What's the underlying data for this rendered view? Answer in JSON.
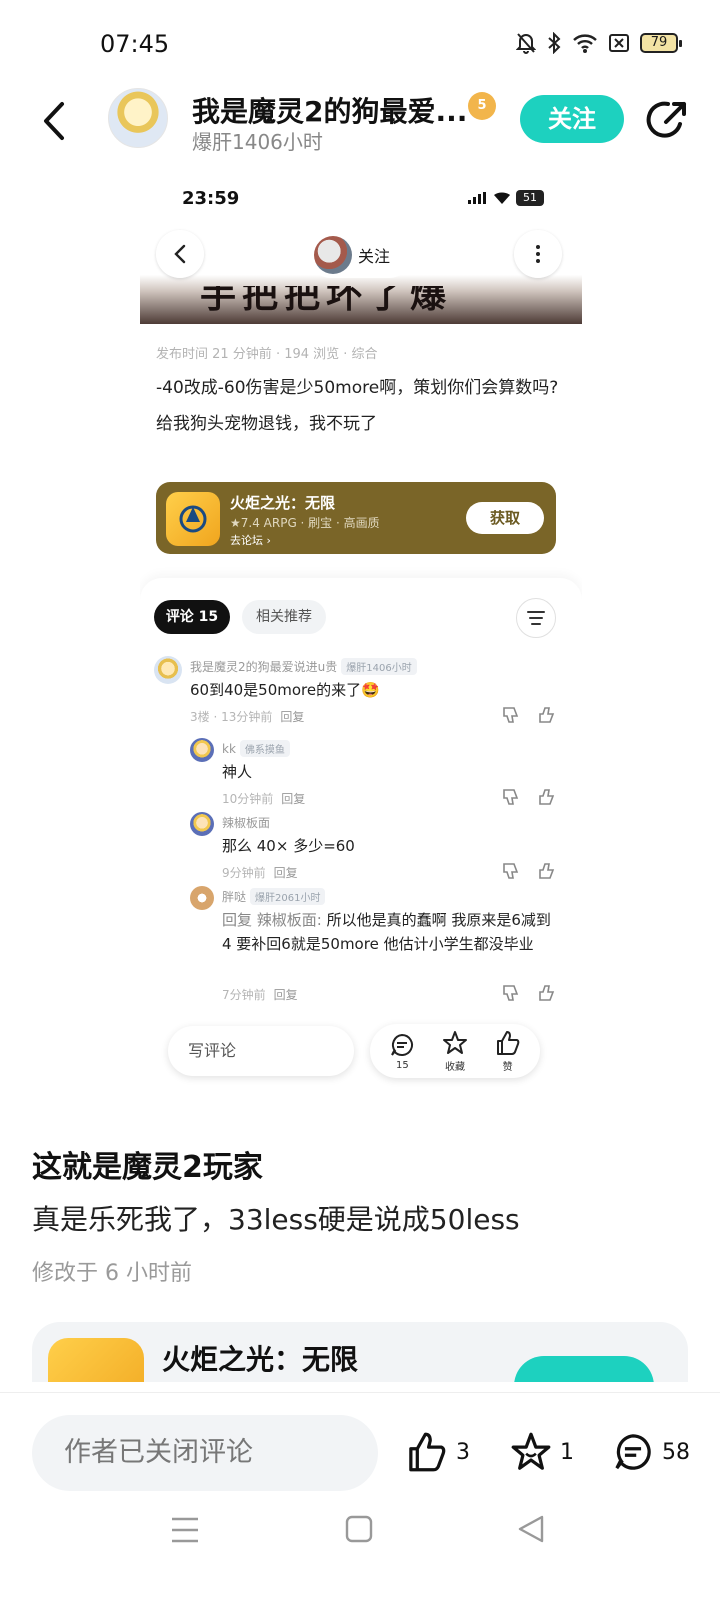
{
  "status_bar": {
    "time": "07:45",
    "battery": "79"
  },
  "header": {
    "name": "我是魔灵2的狗最爱...",
    "level": "5",
    "subtitle": "爆肝1406小时",
    "follow_label": "关注"
  },
  "embedded": {
    "status_time": "23:59",
    "battery": "51",
    "follow_label": "关注",
    "banner_text": "手把把坏了爆",
    "post_meta": "发布时间 21 分钟前 · 194 浏览 · 综合",
    "post_line1": "-40改成-60伤害是少50more啊，策划你们会算数吗?",
    "post_line2": "给我狗头宠物退钱，我不玩了",
    "game": {
      "name": "火炬之光：无限",
      "tags": "★7.4 ARPG · 刷宝 · 高画质",
      "forum": "去论坛 ›",
      "get_label": "获取"
    },
    "tabs": {
      "comments": "评论 15",
      "related": "相关推荐"
    },
    "comments": [
      {
        "name": "我是魔灵2的狗最爱说进u贵",
        "tag": "爆肝1406小时",
        "text": "60到40是50more的来了🤩",
        "meta": "3楼 · 13分钟前",
        "reply": "回复"
      },
      {
        "name": "kk",
        "tag": "佛系摸鱼",
        "text": "神人",
        "meta": "10分钟前",
        "reply": "回复"
      },
      {
        "name": "辣椒板面",
        "tag": "",
        "text": "那么 40× 多少=60",
        "meta": "9分钟前",
        "reply": "回复"
      },
      {
        "name": "胖哒",
        "tag": "爆肝2061小时",
        "reply_prefix": "回复 辣椒板面:",
        "text": "所以他是真的蠢啊 我原来是6减到4 要补回6就是50more 他估计小学生都没毕业",
        "meta": "7分钟前",
        "reply": "回复"
      }
    ],
    "input_placeholder": "写评论",
    "actions": {
      "comments": "15",
      "favorite": "收藏",
      "like": "赞"
    }
  },
  "post": {
    "title": "这就是魔灵2玩家",
    "content": "真是乐死我了，33less硬是说成50less",
    "edited": "修改于 6 小时前"
  },
  "bottom_card": {
    "name": "火炬之光：无限"
  },
  "bottom_bar": {
    "comment_closed": "作者已关闭评论",
    "likes": "3",
    "favorites": "1",
    "comments": "58"
  }
}
